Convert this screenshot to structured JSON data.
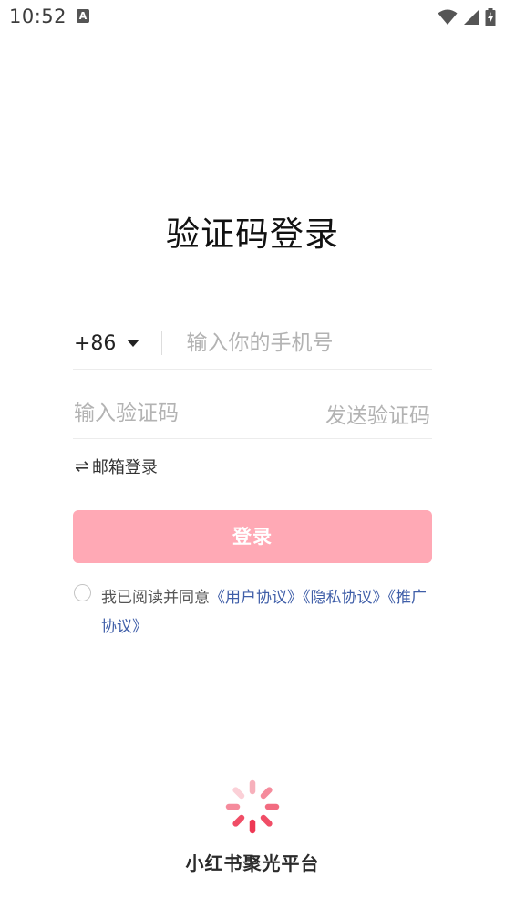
{
  "status_bar": {
    "time": "10:52",
    "notification_letter": "A"
  },
  "page": {
    "title": "验证码登录"
  },
  "phone": {
    "country_code": "+86",
    "placeholder": "输入你的手机号"
  },
  "code": {
    "placeholder": "输入验证码",
    "send_label": "发送验证码"
  },
  "email_login": {
    "icon": "⇌",
    "label": "邮箱登录"
  },
  "login_button": {
    "label": "登录"
  },
  "agreement": {
    "prefix": "我已阅读并同意",
    "user_agreement": "《用户协议》",
    "privacy_agreement": "《隐私协议》",
    "promotion_agreement": "《推广协议》"
  },
  "brand": {
    "name": "小红书聚光平台"
  },
  "colors": {
    "accent": "#ffa9b5",
    "link": "#3f5ea8",
    "logo_red": "#f0415a"
  }
}
